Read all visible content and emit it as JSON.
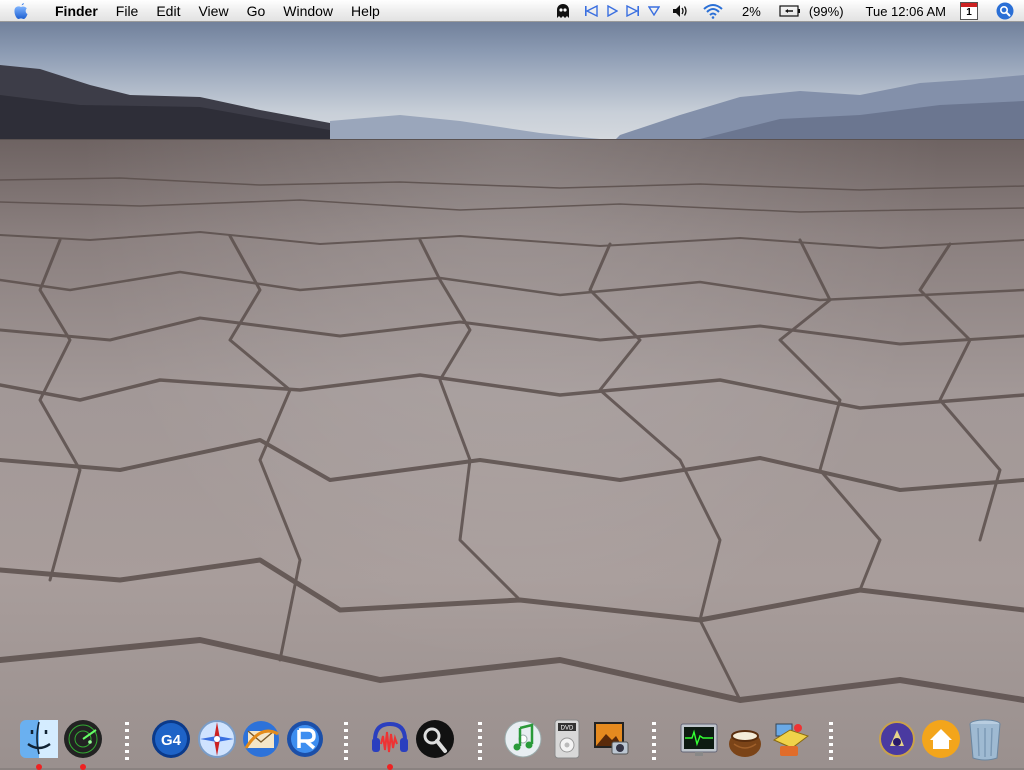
{
  "menubar": {
    "app_name": "Finder",
    "menus": [
      "File",
      "Edit",
      "View",
      "Go",
      "Window",
      "Help"
    ],
    "status": {
      "cpu": "2%",
      "battery": "(99%)",
      "clock": "Tue 12:06 AM",
      "calendar_day": "1"
    }
  },
  "dock": {
    "apps": [
      "finder-icon",
      "radar-icon",
      "g4-icon",
      "safari-compass-icon",
      "mail-icon",
      "realplayer-icon",
      "audacity-icon",
      "spotlight-icon",
      "itunes-icon",
      "dvd-player-icon",
      "iphoto-icon",
      "activity-monitor-icon",
      "coconut-icon",
      "utilities-icon",
      "media-icon",
      "home-icon",
      "trash-icon"
    ]
  },
  "colors": {
    "menubar_bg": "#efefef",
    "spotlight_blue": "#2a6fd6",
    "running_indicator": "#e22222"
  }
}
